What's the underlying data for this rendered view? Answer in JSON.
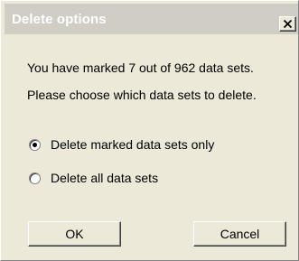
{
  "dialog": {
    "title": "Delete options",
    "close_icon": "close-icon"
  },
  "message": {
    "line1": "You have marked 7 out of 962 data sets.",
    "line2": "Please choose which data sets to delete."
  },
  "options": [
    {
      "label": "Delete marked data sets only",
      "selected": true
    },
    {
      "label": "Delete all data sets",
      "selected": false
    }
  ],
  "buttons": {
    "ok_label": "OK",
    "cancel_label": "Cancel"
  },
  "colors": {
    "face": "#ece9d8",
    "titlebar": "#cfcdc4",
    "title_text": "#ffffff"
  }
}
